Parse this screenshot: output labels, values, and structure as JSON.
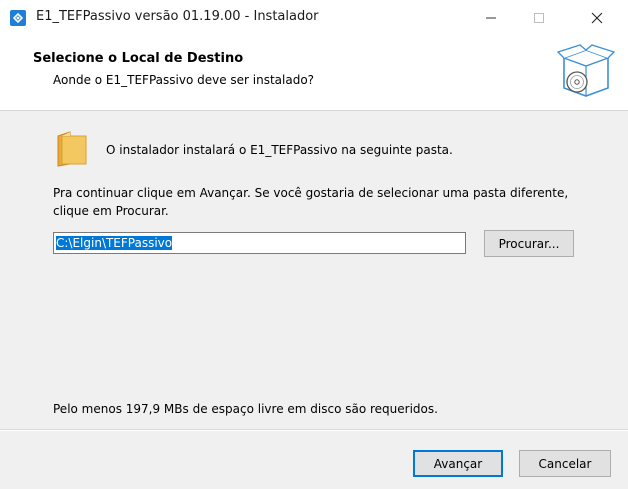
{
  "window": {
    "title": "E1_TEFPassivo versão 01.19.00 - Instalador",
    "app_icon": "installer-app-icon",
    "controls": [
      "minimize-icon",
      "maximize-icon",
      "close-icon"
    ]
  },
  "header": {
    "title": "Selecione o Local de Destino",
    "subtitle": "Aonde o E1_TEFPassivo deve ser instalado?",
    "image_icon": "box-disc-icon"
  },
  "body": {
    "folder_icon": "folder-icon",
    "info": "O instalador instalará o E1_TEFPassivo na seguinte pasta.",
    "instruction": "Pra continuar clique em Avançar. Se você gostaria de selecionar uma pasta diferente, clique em Procurar.",
    "path_value": "C:\\Elgin\\TEFPassivo",
    "browse_label": "Procurar...",
    "space_required": "Pelo menos 197,9 MBs de espaço livre em disco são requeridos."
  },
  "footer": {
    "next_label": "Avançar",
    "cancel_label": "Cancelar"
  },
  "colors": {
    "accent": "#0078d7",
    "app_icon_blue": "#1f7fd6",
    "folder_yellow": "#f4c860",
    "panel_bg": "#f0f0f0"
  }
}
